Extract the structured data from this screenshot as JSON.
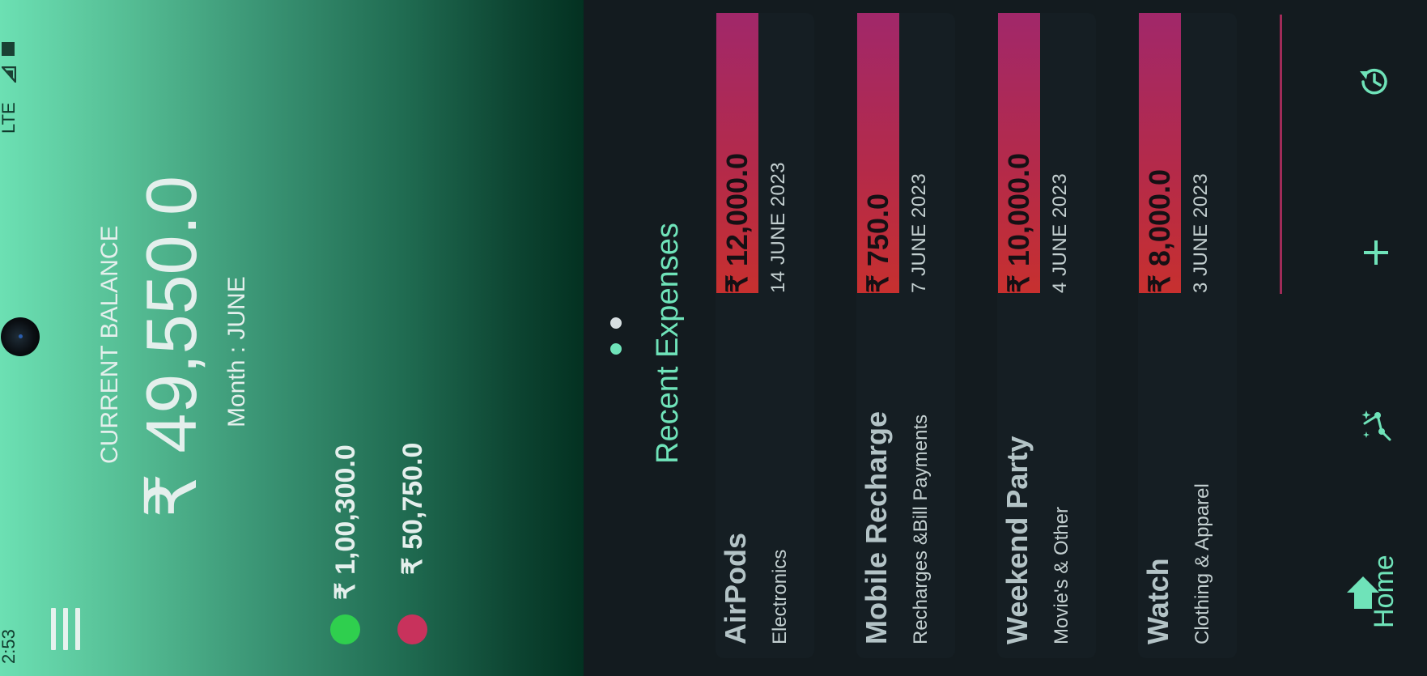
{
  "status_bar": {
    "time": "2:53",
    "network": "LTE"
  },
  "header": {
    "balance_label": "CURRENT BALANCE",
    "balance_value": "₹ 49,550.0",
    "month": "Month : JUNE",
    "income": {
      "amount": "₹ 1,00,300.0",
      "color": "#2fcf4e"
    },
    "expense": {
      "amount": "₹ 50,750.0",
      "color": "#c8325c"
    }
  },
  "pager": {
    "count": 2,
    "active_index": 0
  },
  "recent": {
    "title": "Recent Expenses",
    "items": [
      {
        "name": "AirPods",
        "category": "Electronics",
        "amount": "₹ 12,000.0",
        "date": "14 JUNE 2023"
      },
      {
        "name": "Mobile Recharge",
        "category": "Recharges &Bill Payments",
        "amount": "₹ 750.0",
        "date": "7 JUNE 2023"
      },
      {
        "name": "Weekend Party",
        "category": "Movie's & Other",
        "amount": "₹ 10,000.0",
        "date": "4 JUNE 2023"
      },
      {
        "name": "Watch",
        "category": "Clothing & Apparel",
        "amount": "₹ 8,000.0",
        "date": "3 JUNE 2023"
      }
    ]
  },
  "bottom_nav": {
    "home_label": "Home",
    "icons": [
      "home-icon",
      "analytics-icon",
      "add-icon",
      "history-icon"
    ],
    "accent": "#6fe3b9"
  }
}
